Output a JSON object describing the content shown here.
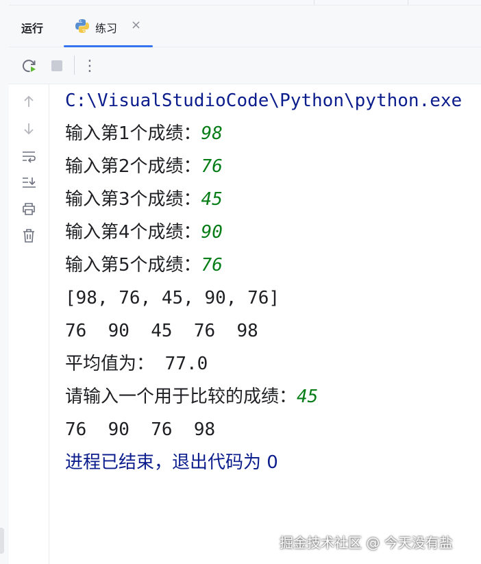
{
  "tool_window": {
    "title": "运行"
  },
  "tab": {
    "label": "练习",
    "close_glyph": "×",
    "icon": "python-icon"
  },
  "toolbar": {
    "rerun_icon": "rerun-icon",
    "stop_icon": "stop-icon",
    "more_icon": "more-vertical-icon",
    "more_glyph": "⋮"
  },
  "gutter": {
    "icons": [
      "up-arrow-icon",
      "down-arrow-icon",
      "soft-wrap-icon",
      "scroll-to-end-icon",
      "print-icon",
      "trash-icon"
    ]
  },
  "console": {
    "command": "C:\\VisualStudioCode\\Python\\python.exe",
    "prompts": [
      {
        "label": "输入第1个成绩：",
        "value": "98"
      },
      {
        "label": "输入第2个成绩：",
        "value": "76"
      },
      {
        "label": "输入第3个成绩：",
        "value": "45"
      },
      {
        "label": "输入第4个成绩：",
        "value": "90"
      },
      {
        "label": "输入第5个成绩：",
        "value": "76"
      }
    ],
    "list_output": "[98, 76, 45, 90, 76]",
    "shuffled_output": "76  90  45  76  98",
    "average_label": "平均值为：",
    "average_value": " 77.0",
    "compare_prompt": {
      "label": "请输入一个用于比较的成绩：",
      "value": "45"
    },
    "filtered_output": "76  90  76  98",
    "exit_message": "进程已结束，退出代码为 0"
  },
  "watermark": "掘金技术社区 @ 今天没有盐",
  "colors": {
    "accent": "#3574f0",
    "input_text": "#067d17",
    "system_text": "#0b1c8c",
    "run_green": "#5fb832"
  }
}
